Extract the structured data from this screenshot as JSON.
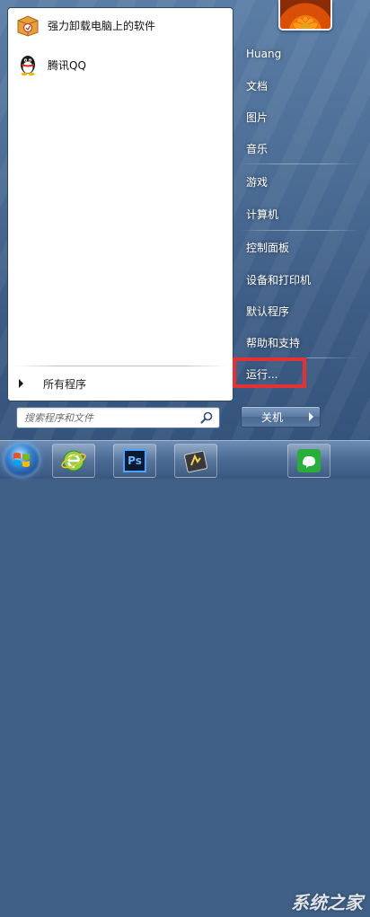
{
  "start_menu": {
    "programs": [
      {
        "label": "强力卸载电脑上的软件",
        "icon": "uninstaller-box-icon"
      },
      {
        "label": "腾讯QQ",
        "icon": "qq-penguin-icon"
      }
    ],
    "all_programs_label": "所有程序",
    "search": {
      "placeholder": "搜索程序和文件",
      "value": ""
    },
    "right_items": [
      {
        "label": "Huang",
        "name": "user-folder"
      },
      {
        "label": "文档",
        "name": "documents"
      },
      {
        "label": "图片",
        "name": "pictures"
      },
      {
        "label": "音乐",
        "name": "music"
      },
      {
        "label": "游戏",
        "name": "games"
      },
      {
        "label": "计算机",
        "name": "computer"
      },
      {
        "label": "控制面板",
        "name": "control-panel"
      },
      {
        "label": "设备和打印机",
        "name": "devices-printers"
      },
      {
        "label": "默认程序",
        "name": "default-programs"
      },
      {
        "label": "帮助和支持",
        "name": "help-support"
      },
      {
        "label": "运行...",
        "name": "run"
      }
    ],
    "shutdown_label": "关机"
  },
  "taskbar": {
    "buttons": [
      "internet-explorer-icon",
      "photoshop-icon",
      "fireworks-icon",
      "wechat-icon"
    ],
    "ps_label": "Ps",
    "watermark": "系统之家"
  },
  "colors": {
    "highlight": "#e53034",
    "accent": "#4e6f97"
  }
}
